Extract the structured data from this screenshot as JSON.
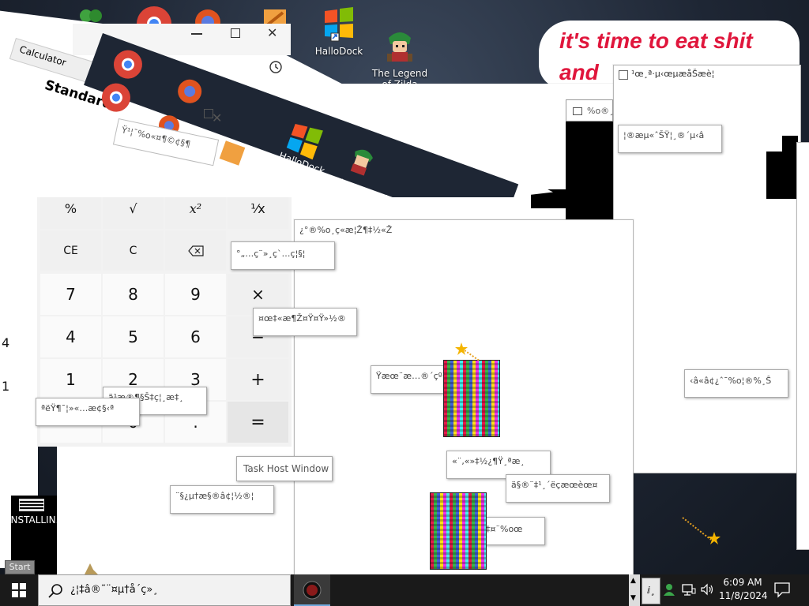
{
  "desktop": {
    "icons": [
      {
        "label": "HalloDock",
        "icon": "hallodock-icon"
      },
      {
        "label": "The Legend\nof Zilda",
        "icon": "zilda-icon"
      }
    ],
    "banner_line1": "it's time to eat shit",
    "banner_line2": "and"
  },
  "calculator": {
    "title": "Calculator",
    "mode": "Standard",
    "keys": [
      [
        "%",
        "√",
        "x²",
        "¹⁄x"
      ],
      [
        "CE",
        "C",
        "⌫",
        ""
      ],
      [
        "7",
        "8",
        "9",
        "×"
      ],
      [
        "4",
        "5",
        "6",
        "−"
      ],
      [
        "1",
        "2",
        "3",
        "+"
      ],
      [
        "",
        "0",
        ".",
        "="
      ]
    ]
  },
  "garbled_windows": {
    "top_right_title": "¹œ¸ª·µ‹œµæåŠæè¦",
    "top_right_2": "%o®¸",
    "right_label": "¦®æµ«ˆŠŸ¦¸®´µ‹â",
    "right_label_2": "‹â«â¢¿ˆ¯%o¦®%¸Ŝ",
    "center_title": "¿°®%o¸ç«æ¦Ž¶‡½«Ž",
    "w1": "°„…ç¨»¸ç`…ç¦§¦",
    "w2": "¤œ‡«æ¶Ž¤Ÿ¤Ÿ»½®",
    "w3": "Ÿæœ¨æ…®´çº³Ž",
    "w4": "ä¹æ®¶§Š‡ç¦¸æ‡¸",
    "w5": "ªëŸ¶¯¦»«…æ¢§‹ª",
    "w6": "«¨‚«»‡½¿¶Ÿ¸ªæ¸",
    "w7": "ä§®¨‡¹¸´ëçæœèœ¤",
    "w8": "¨§¿µ†æ§®â¢¦½®¦",
    "w9": "‡¤¨%oœ",
    "diag_title": "Ÿ¹¦¯%o«¤¶©¢§¶"
  },
  "task_host": "Task Host Window",
  "installing": "INSTALLIN...",
  "start_label": "Start",
  "taskbar": {
    "search_text": "¿¦‡â®˜¨¤µ†å´ç»¸",
    "time": "6:09 AM",
    "date": "11/8/2024"
  },
  "colors": {
    "taskbar_bg": "#1a1a1a",
    "banner_text": "#e0163c"
  }
}
